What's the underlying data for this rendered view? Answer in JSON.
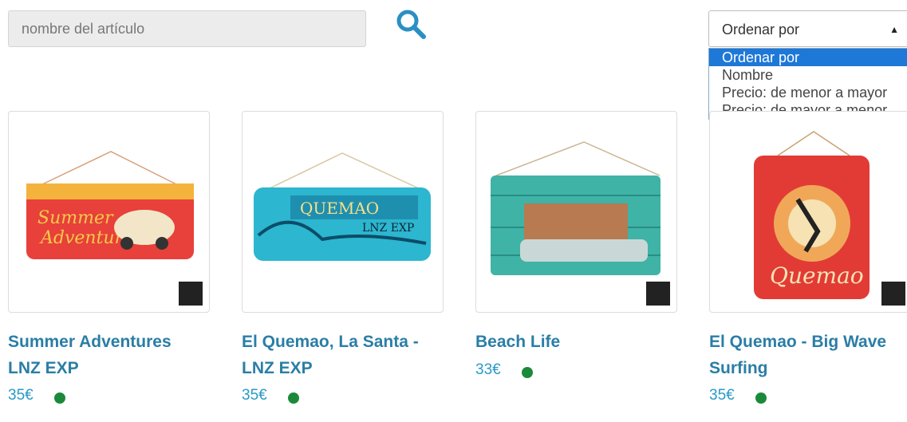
{
  "search": {
    "placeholder": "nombre del artículo",
    "icon": "search-icon"
  },
  "sort": {
    "selected": "Ordenar por",
    "options": [
      "Ordenar por",
      "Nombre",
      "Precio: de menor a mayor",
      "Precio: de mayor a menor"
    ]
  },
  "colors": {
    "accent": "#2a7ea6",
    "price": "#2a9ac8",
    "stock": "#1a8a3a",
    "selected_option": "#1e78d7"
  },
  "products": [
    {
      "title_line1": "Summer Adventures",
      "title_line2": "LNZ EXP",
      "price": "35€",
      "in_stock": true
    },
    {
      "title_line1": "El Quemao, La Santa -",
      "title_line2": "LNZ EXP",
      "price": "35€",
      "in_stock": true
    },
    {
      "title_line1": "Beach Life",
      "title_line2": "",
      "price": "33€",
      "in_stock": true
    },
    {
      "title_line1": "El Quemao - Big Wave",
      "title_line2": "Surfing",
      "price": "35€",
      "in_stock": true
    }
  ]
}
